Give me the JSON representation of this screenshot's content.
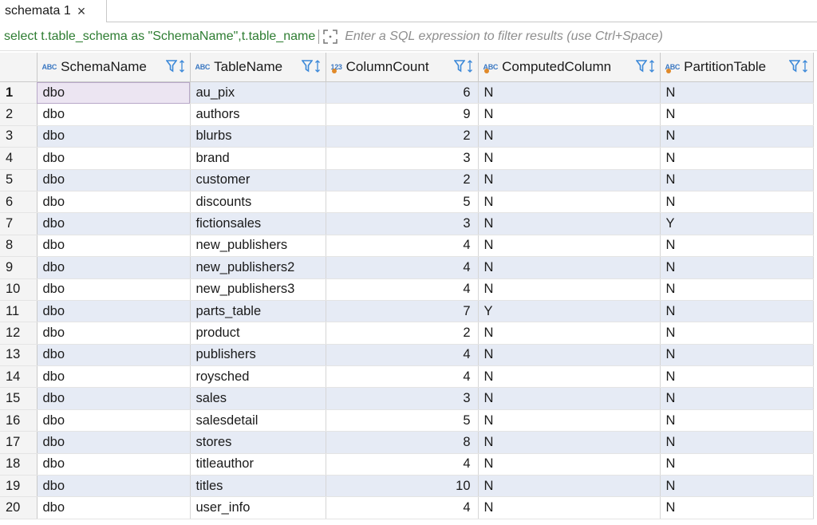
{
  "tab": {
    "title": "schemata 1",
    "close_glyph": "×"
  },
  "filter": {
    "query": "select t.table_schema as \"SchemaName\",t.table_name",
    "placeholder": "Enter a SQL expression to filter results (use Ctrl+Space)"
  },
  "columns": [
    {
      "label": "SchemaName",
      "type_badge": "ABC",
      "numeric": false
    },
    {
      "label": "TableName",
      "type_badge": "ABC",
      "numeric": false
    },
    {
      "label": "ColumnCount",
      "type_badge": "123",
      "numeric": true
    },
    {
      "label": "ComputedColumn",
      "type_badge": "ABC",
      "numeric": false
    },
    {
      "label": "PartitionTable",
      "type_badge": "ABC",
      "numeric": false
    }
  ],
  "rows": [
    [
      "1",
      "dbo",
      "au_pix",
      "6",
      "N",
      "N"
    ],
    [
      "2",
      "dbo",
      "authors",
      "9",
      "N",
      "N"
    ],
    [
      "3",
      "dbo",
      "blurbs",
      "2",
      "N",
      "N"
    ],
    [
      "4",
      "dbo",
      "brand",
      "3",
      "N",
      "N"
    ],
    [
      "5",
      "dbo",
      "customer",
      "2",
      "N",
      "N"
    ],
    [
      "6",
      "dbo",
      "discounts",
      "5",
      "N",
      "N"
    ],
    [
      "7",
      "dbo",
      "fictionsales",
      "3",
      "N",
      "Y"
    ],
    [
      "8",
      "dbo",
      "new_publishers",
      "4",
      "N",
      "N"
    ],
    [
      "9",
      "dbo",
      "new_publishers2",
      "4",
      "N",
      "N"
    ],
    [
      "10",
      "dbo",
      "new_publishers3",
      "4",
      "N",
      "N"
    ],
    [
      "11",
      "dbo",
      "parts_table",
      "7",
      "Y",
      "N"
    ],
    [
      "12",
      "dbo",
      "product",
      "2",
      "N",
      "N"
    ],
    [
      "13",
      "dbo",
      "publishers",
      "4",
      "N",
      "N"
    ],
    [
      "14",
      "dbo",
      "roysched",
      "4",
      "N",
      "N"
    ],
    [
      "15",
      "dbo",
      "sales",
      "3",
      "N",
      "N"
    ],
    [
      "16",
      "dbo",
      "salesdetail",
      "5",
      "N",
      "N"
    ],
    [
      "17",
      "dbo",
      "stores",
      "8",
      "N",
      "N"
    ],
    [
      "18",
      "dbo",
      "titleauthor",
      "4",
      "N",
      "N"
    ],
    [
      "19",
      "dbo",
      "titles",
      "10",
      "N",
      "N"
    ],
    [
      "20",
      "dbo",
      "user_info",
      "4",
      "N",
      "N"
    ]
  ],
  "colors": {
    "query_text": "#2e7d32",
    "alt_row": "#e6ebf5",
    "type_badge": "#3b78c2",
    "filter_icon": "#3b88d8"
  },
  "icons": {
    "tab_close": "close-icon",
    "expand": "expand-icon",
    "column_filter": "filter-icon",
    "column_sort": "sort-icon"
  }
}
